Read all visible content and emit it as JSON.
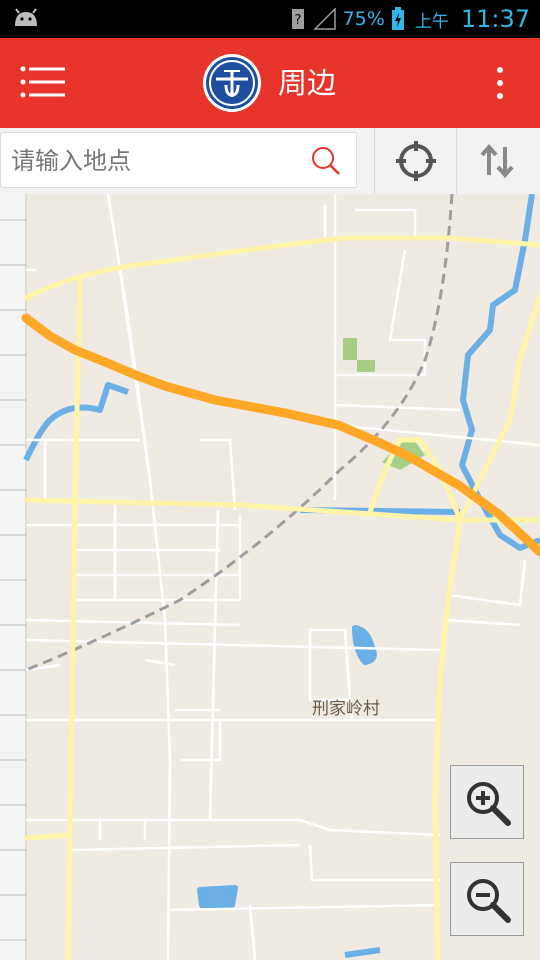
{
  "status_bar": {
    "battery_percent": "75%",
    "am_pm": "上午",
    "time": "11:37"
  },
  "app_bar": {
    "title": "周边",
    "background": "#e8342b"
  },
  "search": {
    "placeholder": "请输入地点",
    "value": ""
  },
  "map": {
    "place_label": "刑家岭村",
    "route_color": "#ffa726",
    "road_color": "#fff9c4",
    "water_color": "#6aafe6"
  },
  "icons": [
    "android-icon",
    "help-icon",
    "signal-icon",
    "battery-icon",
    "menu-icon",
    "logo-icon",
    "more-icon",
    "search-icon",
    "locate-icon",
    "route-swap-icon",
    "zoom-in-icon",
    "zoom-out-icon"
  ]
}
